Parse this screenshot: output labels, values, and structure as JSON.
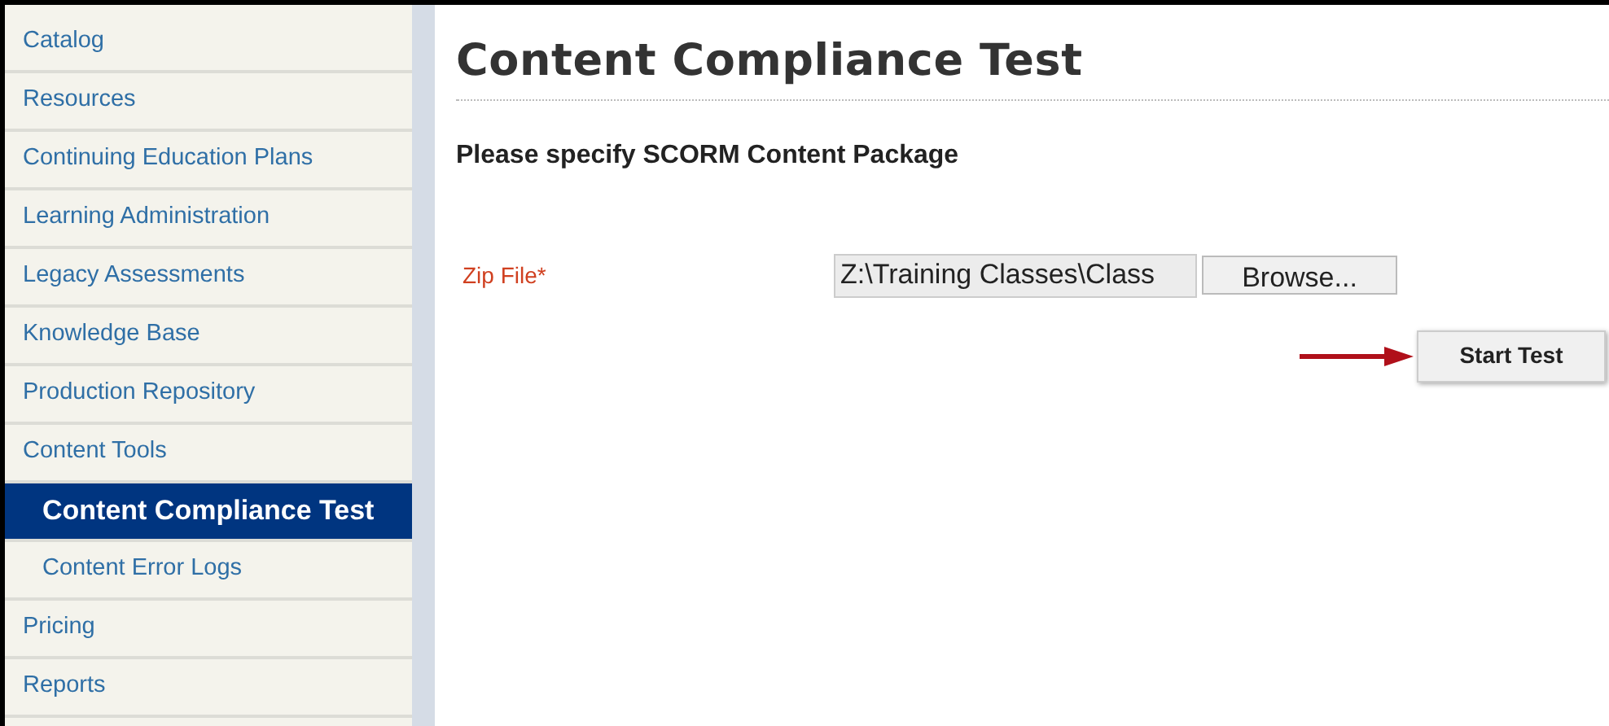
{
  "sidebar": {
    "items": [
      {
        "label": "Catalog",
        "selected": false
      },
      {
        "label": "Resources",
        "selected": false
      },
      {
        "label": "Continuing Education Plans",
        "selected": false
      },
      {
        "label": "Learning Administration",
        "selected": false
      },
      {
        "label": "Legacy Assessments",
        "selected": false
      },
      {
        "label": "Knowledge Base",
        "selected": false
      },
      {
        "label": "Production Repository",
        "selected": false
      },
      {
        "label": "Content Tools",
        "selected": false,
        "children": [
          {
            "label": "Content Compliance Test",
            "selected": true
          },
          {
            "label": "Content Error Logs",
            "selected": false
          }
        ]
      },
      {
        "label": "Pricing",
        "selected": false
      },
      {
        "label": "Reports",
        "selected": false
      }
    ]
  },
  "page": {
    "title": "Content Compliance Test",
    "subtitle": "Please specify SCORM Content Package",
    "form": {
      "label": "Zip File*",
      "value": "Z:\\Training Classes\\Class",
      "browse": "Browse...",
      "submit": "Start Test"
    }
  }
}
